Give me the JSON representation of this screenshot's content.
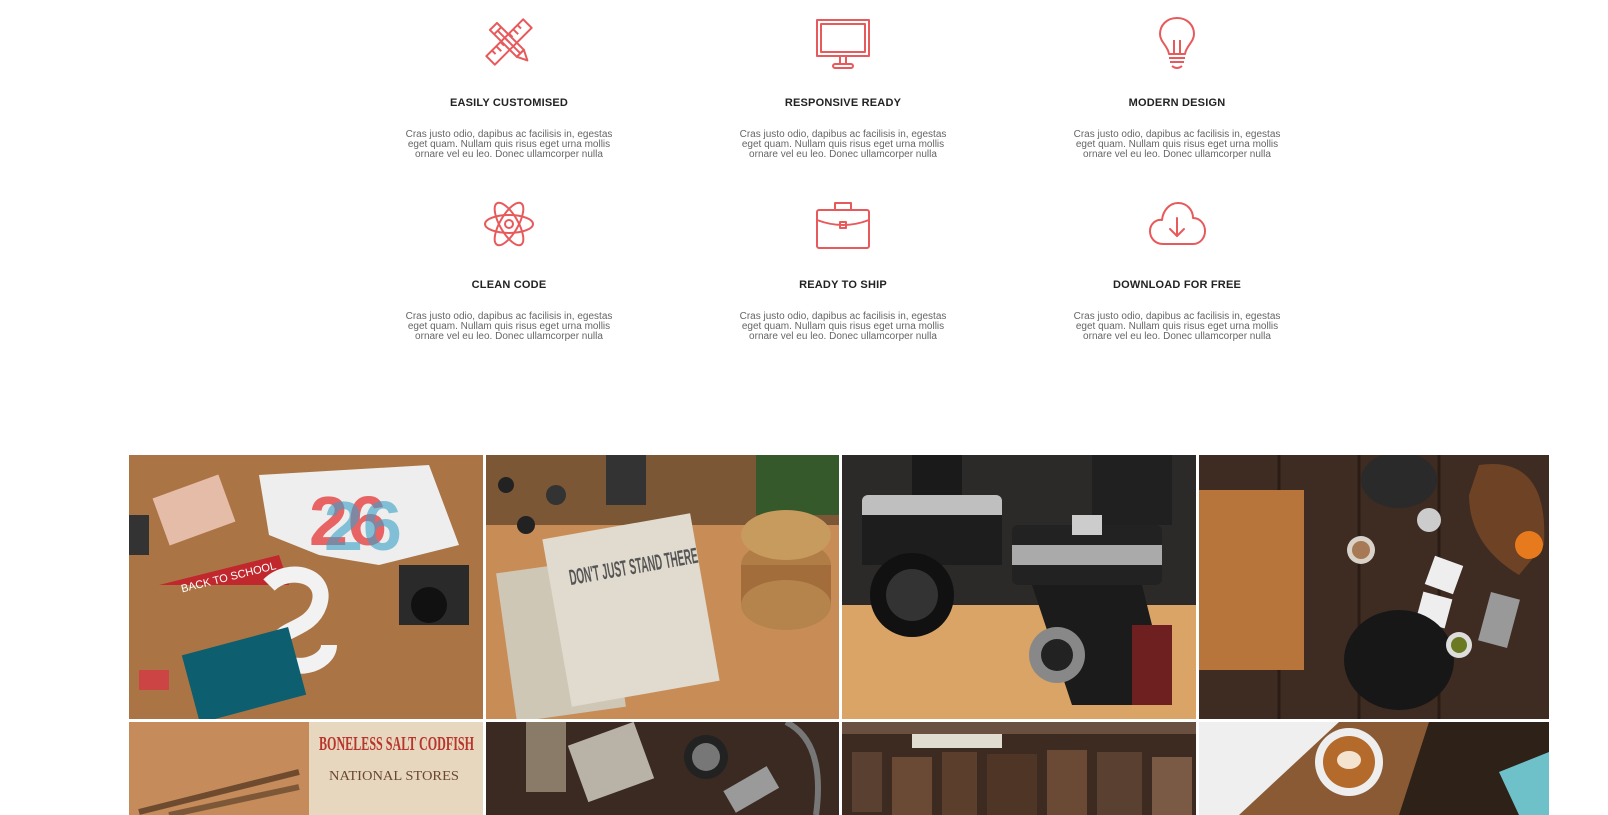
{
  "features": [
    {
      "title": "EASILY CUSTOMISED",
      "icon": "pencil-ruler-icon",
      "text": "Cras justo odio, dapibus ac facilisis in, egestas eget quam. Nullam quis risus eget urna mollis ornare vel eu leo. Donec ullamcorper nulla"
    },
    {
      "title": "RESPONSIVE READY",
      "icon": "monitor-icon",
      "text": "Cras justo odio, dapibus ac facilisis in, egestas eget quam. Nullam quis risus eget urna mollis ornare vel eu leo. Donec ullamcorper nulla"
    },
    {
      "title": "MODERN DESIGN",
      "icon": "lightbulb-icon",
      "text": "Cras justo odio, dapibus ac facilisis in, egestas eget quam. Nullam quis risus eget urna mollis ornare vel eu leo. Donec ullamcorper nulla"
    },
    {
      "title": "CLEAN CODE",
      "icon": "atom-icon",
      "text": "Cras justo odio, dapibus ac facilisis in, egestas eget quam. Nullam quis risus eget urna mollis ornare vel eu leo. Donec ullamcorper nulla"
    },
    {
      "title": "READY TO SHIP",
      "icon": "briefcase-icon",
      "text": "Cras justo odio, dapibus ac facilisis in, egestas eget quam. Nullam quis risus eget urna mollis ornare vel eu leo. Donec ullamcorper nulla"
    },
    {
      "title": "DOWNLOAD FOR FREE",
      "icon": "cloud-download-icon",
      "text": "Cras justo odio, dapibus ac facilisis in, egestas eget quam. Nullam quis risus eget urna mollis ornare vel eu leo. Donec ullamcorper nulla"
    }
  ],
  "gallery": {
    "tiles": [
      {
        "subject": "desk flatlay with t-shirt, pennant, ampersand and camera",
        "lettering": [
          "BACK TO SCHOOL"
        ]
      },
      {
        "subject": "notebooks and wooden coasters",
        "lettering": [
          "DON'T JUST STAND THERE"
        ]
      },
      {
        "subject": "vintage cameras on wooden shelf",
        "lettering": []
      },
      {
        "subject": "overhead kitchen table with cutting board, mortar and spices",
        "lettering": []
      },
      {
        "subject": "vintage sign",
        "lettering": [
          "BONELESS SALT CODFISH",
          "NATIONAL STORES"
        ]
      },
      {
        "subject": "old tools on dark wood",
        "lettering": []
      },
      {
        "subject": "letterpress wood type",
        "lettering": []
      },
      {
        "subject": "coffee cup on wooden table",
        "lettering": []
      }
    ]
  },
  "colors": {
    "accent": "#e8595c",
    "title": "#222222",
    "body_text": "#666666",
    "background": "#ffffff"
  }
}
